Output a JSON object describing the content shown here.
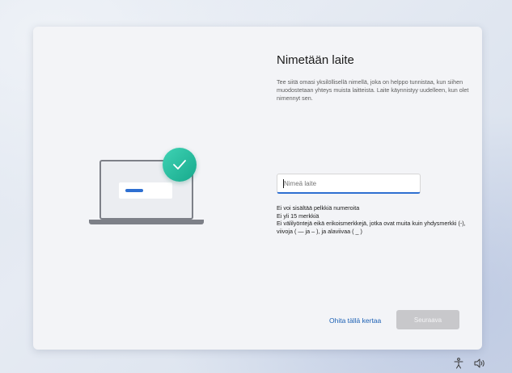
{
  "header": {
    "title": "Nimetään laite"
  },
  "description": "Tee siitä omasi yksilöllisellä nimellä, joka on helppo tunnistaa, kun siihen muodostetaan yhteys muista laitteista. Laite käynnistyy uudelleen, kun olet nimennyt sen.",
  "name_input": {
    "placeholder": "Nimeä laite",
    "value": ""
  },
  "rules": [
    "Ei voi sisältää pelkkiä numeroita",
    "Ei yli 15 merkkiä",
    "Ei välilyöntejä eikä erikoismerkkejä, jotka ovat muita kuin yhdysmerkki (-), viivoja ( — ja – ), ja alaviivaa ( _ )"
  ],
  "actions": {
    "skip_label": "Ohita tällä kertaa",
    "next_label": "Seuraava"
  },
  "icons": {
    "illustration": "laptop-icon",
    "badge": "checkmark-icon",
    "tray_left": "accessibility-icon",
    "tray_right": "volume-icon"
  },
  "colors": {
    "accent": "#2e6fd1",
    "badge": "#1fb897",
    "link": "#1a5fb4",
    "disabled_button": "#c8c8cb"
  }
}
